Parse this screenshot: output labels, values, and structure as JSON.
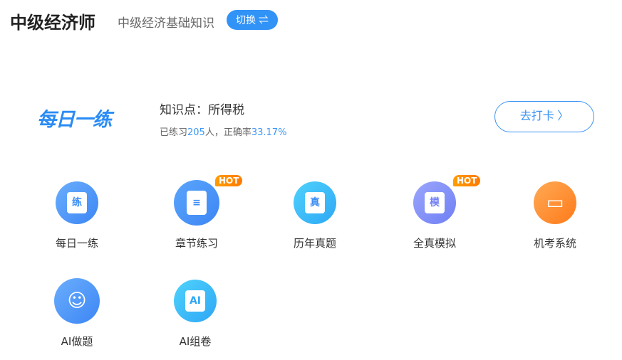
{
  "header": {
    "title": "中级经济师",
    "subject": "中级经济基础知识",
    "switch_label": "切换 ⇌"
  },
  "daily": {
    "logo": "每日一练",
    "knowledge_point": "知识点：所得税",
    "stats_prefix": "已练习",
    "count": "205",
    "stats_mid": "人，正确率",
    "accuracy": "33.17%",
    "checkin_label": "去打卡 〉"
  },
  "tiles": [
    {
      "label": "每日一练",
      "glyph": "练",
      "hot": ""
    },
    {
      "label": "章节练习",
      "glyph": "≡",
      "hot": "HOT"
    },
    {
      "label": "历年真题",
      "glyph": "真",
      "hot": ""
    },
    {
      "label": "全真模拟",
      "glyph": "模",
      "hot": "HOT"
    },
    {
      "label": "机考系统",
      "glyph": "▭",
      "hot": ""
    },
    {
      "label": "AI做题",
      "glyph": "☺",
      "hot": ""
    },
    {
      "label": "AI组卷",
      "glyph": "AI",
      "hot": ""
    }
  ]
}
